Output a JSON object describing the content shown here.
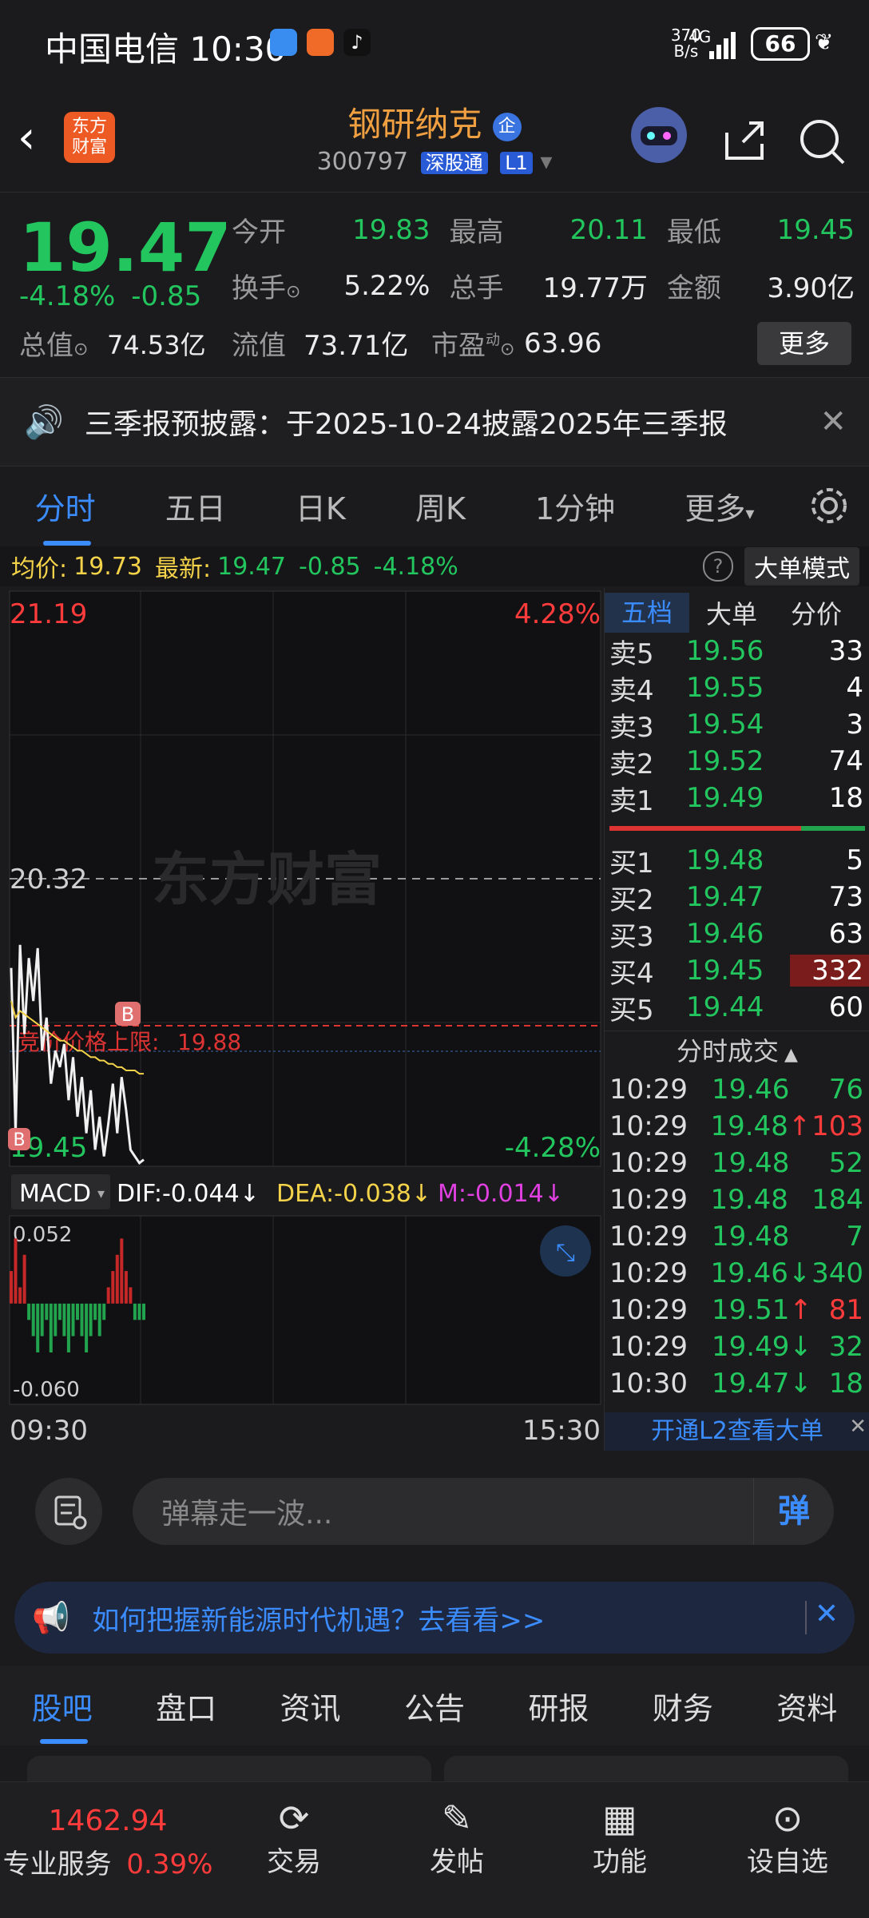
{
  "status_bar": {
    "carrier_time": "中国电信 10:30",
    "net_speed_value": "370",
    "net_speed_unit": "B/s",
    "network_type": "4G",
    "battery": "66"
  },
  "header": {
    "logo_line1": "东方",
    "logo_line2": "财富",
    "stock_name": "钢研纳克",
    "badge": "企",
    "code": "300797",
    "market": "深股通",
    "level": "L1"
  },
  "quote": {
    "price": "19.47",
    "change_pct": "-4.18%",
    "change": "-0.85",
    "fields": [
      {
        "label": "今开",
        "value": "19.83",
        "color": "green"
      },
      {
        "label": "最高",
        "value": "20.11",
        "color": "green"
      },
      {
        "label": "最低",
        "value": "19.45",
        "color": "green"
      },
      {
        "label": "换手",
        "value": "5.22%",
        "color": "white"
      },
      {
        "label": "总手",
        "value": "19.77万",
        "color": "white"
      },
      {
        "label": "金额",
        "value": "3.90亿",
        "color": "white"
      },
      {
        "label": "总值",
        "value": "74.53亿",
        "color": "white"
      },
      {
        "label": "流值",
        "value": "73.71亿",
        "color": "white"
      },
      {
        "label": "市盈",
        "value": "63.96",
        "color": "white"
      }
    ],
    "pe_superscript": "动",
    "more_label": "更多"
  },
  "notice": {
    "text": "三季报预披露：于2025-10-24披露2025年三季报"
  },
  "tabs": [
    "分时",
    "五日",
    "日K",
    "周K",
    "1分钟",
    "更多"
  ],
  "active_tab": 0,
  "info_line": {
    "avg_label": "均价:",
    "avg_value": "19.73",
    "latest_label": "最新:",
    "latest_value": "19.47",
    "change": "-0.85",
    "change_pct": "-4.18%",
    "big_order_mode": "大单模式"
  },
  "chart": {
    "top_price": "21.19",
    "top_pct": "4.28%",
    "mid_price": "20.32",
    "bottom_price": "19.45",
    "bottom_pct": "-4.28%",
    "limit_label": "竞价价格上限:",
    "limit_value": "19.88",
    "watermark": "东方财富",
    "marker_b": "B",
    "macd_label": "MACD",
    "dif": "DIF:-0.044",
    "dea": "DEA:-0.038",
    "m": "M:-0.014",
    "macd_top": "0.052",
    "macd_bottom": "-0.060",
    "time_start": "09:30",
    "time_end": "15:30"
  },
  "chart_data": {
    "type": "line",
    "title": "",
    "xlabel": "",
    "ylabel": "",
    "ylim": [
      19.45,
      21.19
    ],
    "x": [
      "09:30",
      "09:32",
      "09:34",
      "09:36",
      "09:38",
      "09:40",
      "09:42",
      "09:44",
      "09:46",
      "09:48",
      "09:50",
      "09:52",
      "09:54",
      "09:56",
      "09:58",
      "10:00",
      "10:02",
      "10:04",
      "10:06",
      "10:08",
      "10:10",
      "10:12",
      "10:14",
      "10:16",
      "10:18",
      "10:20",
      "10:22",
      "10:24",
      "10:26",
      "10:28",
      "10:30"
    ],
    "series": [
      {
        "name": "",
        "values": [
          20.05,
          19.55,
          20.12,
          19.85,
          20.08,
          19.95,
          20.11,
          19.8,
          19.9,
          19.7,
          19.8,
          19.75,
          19.82,
          19.65,
          19.78,
          19.6,
          19.72,
          19.55,
          19.68,
          19.5,
          19.6,
          19.48,
          19.58,
          19.7,
          19.55,
          19.72,
          19.62,
          19.5,
          19.48,
          19.46,
          19.47
        ]
      },
      {
        "name": "",
        "values": [
          19.95,
          19.9,
          19.92,
          19.91,
          19.9,
          19.89,
          19.88,
          19.87,
          19.86,
          19.85,
          19.84,
          19.83,
          19.83,
          19.82,
          19.81,
          19.8,
          19.8,
          19.79,
          19.78,
          19.78,
          19.77,
          19.77,
          19.76,
          19.76,
          19.75,
          19.75,
          19.74,
          19.74,
          19.74,
          19.73,
          19.73
        ]
      }
    ],
    "macd": {
      "ylim": [
        -0.06,
        0.052
      ],
      "histogram": [
        0.02,
        0.04,
        0.01,
        0.03,
        -0.01,
        -0.02,
        -0.03,
        -0.02,
        -0.01,
        -0.03,
        -0.02,
        -0.01,
        -0.02,
        -0.03,
        -0.02,
        -0.01,
        -0.02,
        -0.03,
        -0.02,
        -0.01,
        -0.02,
        -0.01,
        0.01,
        0.02,
        0.03,
        0.04,
        0.02,
        0.01,
        -0.01,
        -0.01,
        -0.01
      ]
    }
  },
  "order_book": {
    "tabs": [
      "五档",
      "大单",
      "分价"
    ],
    "sells": [
      {
        "label": "卖5",
        "price": "19.56",
        "vol": "33"
      },
      {
        "label": "卖4",
        "price": "19.55",
        "vol": "4"
      },
      {
        "label": "卖3",
        "price": "19.54",
        "vol": "3"
      },
      {
        "label": "卖2",
        "price": "19.52",
        "vol": "74"
      },
      {
        "label": "卖1",
        "price": "19.49",
        "vol": "18"
      }
    ],
    "buys": [
      {
        "label": "买1",
        "price": "19.48",
        "vol": "5"
      },
      {
        "label": "买2",
        "price": "19.47",
        "vol": "73"
      },
      {
        "label": "买3",
        "price": "19.46",
        "vol": "63"
      },
      {
        "label": "买4",
        "price": "19.45",
        "vol": "332"
      },
      {
        "label": "买5",
        "price": "19.44",
        "vol": "60"
      }
    ],
    "trades_title": "分时成交",
    "trades": [
      {
        "time": "10:29",
        "price": "19.46",
        "dir": "",
        "vol": "76",
        "vol_color": "green"
      },
      {
        "time": "10:29",
        "price": "19.48",
        "dir": "↑",
        "vol": "103",
        "vol_color": "red"
      },
      {
        "time": "10:29",
        "price": "19.48",
        "dir": "",
        "vol": "52",
        "vol_color": "green"
      },
      {
        "time": "10:29",
        "price": "19.48",
        "dir": "",
        "vol": "184",
        "vol_color": "green"
      },
      {
        "time": "10:29",
        "price": "19.48",
        "dir": "",
        "vol": "7",
        "vol_color": "green"
      },
      {
        "time": "10:29",
        "price": "19.46",
        "dir": "↓",
        "vol": "340",
        "vol_color": "green"
      },
      {
        "time": "10:29",
        "price": "19.51",
        "dir": "↑",
        "vol": "81",
        "vol_color": "red"
      },
      {
        "time": "10:29",
        "price": "19.49",
        "dir": "↓",
        "vol": "32",
        "vol_color": "green"
      },
      {
        "time": "10:30",
        "price": "19.47",
        "dir": "↓",
        "vol": "18",
        "vol_color": "green"
      }
    ],
    "l2_link": "开通L2查看大单"
  },
  "danmaku": {
    "placeholder": "弹幕走一波...",
    "send_label": "弹"
  },
  "promo": {
    "text": "如何把握新能源时代机遇？去看看>>"
  },
  "subtabs": [
    "股吧",
    "盘口",
    "资讯",
    "公告",
    "研报",
    "财务",
    "资料"
  ],
  "nav": {
    "index_value": "1462.94",
    "service_label": "专业服务",
    "service_pct": "0.39%",
    "items": [
      "交易",
      "发帖",
      "功能",
      "设自选"
    ]
  }
}
